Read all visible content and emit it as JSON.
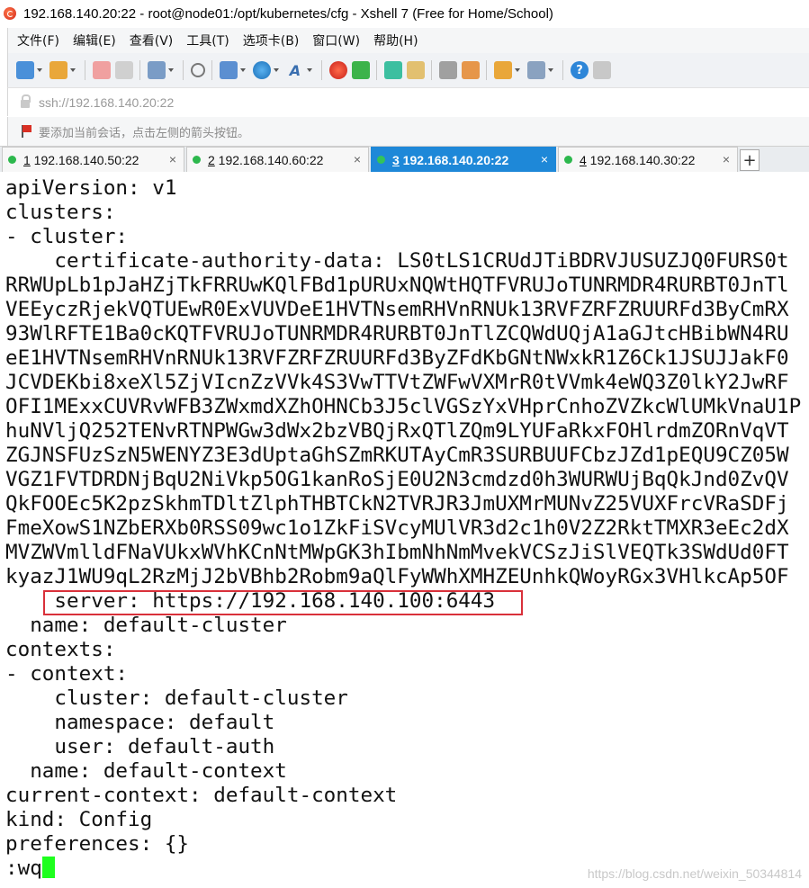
{
  "window": {
    "title": "192.168.140.20:22 - root@node01:/opt/kubernetes/cfg - Xshell 7 (Free for Home/School)"
  },
  "menu": [
    "文件(F)",
    "编辑(E)",
    "查看(V)",
    "工具(T)",
    "选项卡(B)",
    "窗口(W)",
    "帮助(H)"
  ],
  "address": {
    "value": "ssh://192.168.140.20:22"
  },
  "hint": {
    "text": "要添加当前会话，点击左侧的箭头按钮。"
  },
  "tabs": [
    {
      "number": "1",
      "host": " 192.168.140.50:22",
      "active": false
    },
    {
      "number": "2",
      "host": " 192.168.140.60:22",
      "active": false
    },
    {
      "number": "3",
      "host": " 192.168.140.20:22",
      "active": true
    },
    {
      "number": "4",
      "host": " 192.168.140.30:22",
      "active": false
    }
  ],
  "tab_add_label": "+",
  "tab_close_label": "×",
  "terminal": {
    "lines": [
      "apiVersion: v1",
      "clusters:",
      "- cluster:",
      "    certificate-authority-data: LS0tLS1CRUdJTiBDRVJUSUZJQ0FURS0t",
      "RRWUpLb1pJaHZjTkFRRUwKQlFBd1pURUxNQWtHQTFVRUJoTUNRMDR4RURBT0JnTl",
      "VEEyczRjekVQTUEwR0ExVUVDeE1HVTNsemRHVnRNUk13RVFZRFZRUURFd3ByCmRX",
      "93WlRFTE1Ba0cKQTFVRUJoTUNRMDR4RURBT0JnTlZCQWdUQjA1aGJtcHBibWN4RU",
      "eE1HVTNsemRHVnRNUk13RVFZRFZRUURFd3ByZFdKbGNtNWxkR1Z6Ck1JSUJJakF0",
      "JCVDEKbi8xeXl5ZjVIcnZzVVk4S3VwTTVtZWFwVXMrR0tVVmk4eWQ3Z0lkY2JwRF",
      "OFI1MExxCUVRvWFB3ZWxmdXZhOHNCb3J5clVGSzYxVHprCnhoZVZkcWlUMkVnaU1P",
      "huNVljQ252TENvRTNPWGw3dWx2bzVBQjRxQTlZQm9LYUFaRkxFOHlrdmZORnVqVT",
      "ZGJNSFUzSzN5WENYZ3E3dUptaGhSZmRKUTAyCmR3SURBUUFCbzJZd1pEQU9CZ05W",
      "VGZ1FVTDRDNjBqU2NiVkp5OG1kanRoSjE0U2N3cmdzd0h3WURWUjBqQkJnd0ZvQV",
      "QkFOOEc5K2pzSkhmTDltZlphTHBTCkN2TVRJR3JmUXMrMUNvZ25VUXFrcVRaSDFj",
      "FmeXowS1NZbERXb0RSS09wc1o1ZkFiSVcyMUlVR3d2c1h0V2Z2RktTMXR3eEc2dX",
      "MVZWVmlldFNaVUkxWVhKCnNtMWpGK3hIbmNhNmMvekVCSzJiSlVEQTk3SWdUd0FT",
      "kyazJ1WU9qL2RzMjJ2bVBhb2Robm9aQlFyWWhXMHZEUnhkQWoyRGx3VHlkcAp5OF",
      "    server: https://192.168.140.100:6443",
      "  name: default-cluster",
      "contexts:",
      "- context:",
      "    cluster: default-cluster",
      "    namespace: default",
      "    user: default-auth",
      "  name: default-context",
      "current-context: default-context",
      "kind: Config",
      "preferences: {}",
      ":wq"
    ]
  },
  "watermark": "https://blog.csdn.net/weixin_50344814",
  "colors": {
    "tab_active": "#1e88d8",
    "highlight_box": "#d9303a",
    "cursor": "#1eff1e"
  }
}
